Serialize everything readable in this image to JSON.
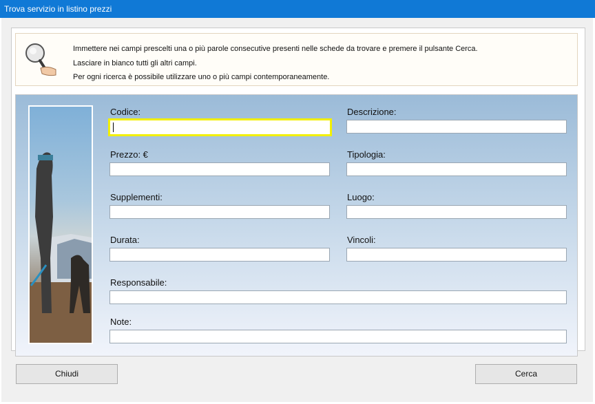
{
  "window": {
    "title": "Trova servizio in listino prezzi"
  },
  "info": {
    "icon": "magnifier-icon",
    "lines": [
      "Immettere nei campi prescelti una o più parole consecutive presenti nelle schede da trovare e premere il pulsante Cerca.",
      "Lasciare in bianco tutti gli altri campi.",
      "Per ogni ricerca è possibile utilizzare uno o più campi contemporaneamente."
    ]
  },
  "fields": {
    "codice": {
      "label": "Codice:",
      "value": ""
    },
    "descrizione": {
      "label": "Descrizione:",
      "value": ""
    },
    "prezzo": {
      "label": "Prezzo: €",
      "value": ""
    },
    "tipologia": {
      "label": "Tipologia:",
      "value": ""
    },
    "supplementi": {
      "label": "Supplementi:",
      "value": ""
    },
    "luogo": {
      "label": "Luogo:",
      "value": ""
    },
    "durata": {
      "label": "Durata:",
      "value": ""
    },
    "vincoli": {
      "label": "Vincoli:",
      "value": ""
    },
    "responsabile": {
      "label": "Responsabile:",
      "value": ""
    },
    "note": {
      "label": "Note:",
      "value": ""
    }
  },
  "buttons": {
    "close": "Chiudi",
    "search": "Cerca"
  },
  "colors": {
    "titlebar": "#1079d6",
    "focus_border": "#f3f000"
  }
}
